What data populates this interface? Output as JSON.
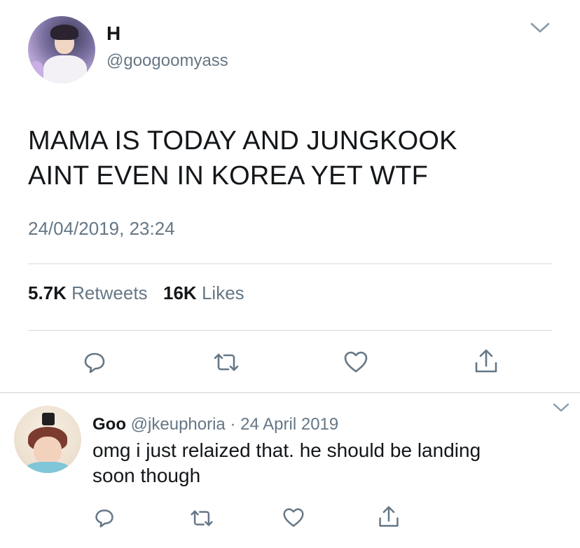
{
  "tweet": {
    "display_name": "H",
    "handle": "@googoomyass",
    "text_line1": "MAMA IS TODAY AND JUNGKOOK",
    "text_line2": "AINT EVEN IN KOREA YET WTF",
    "timestamp": "24/04/2019, 23:24",
    "retweets_count": "5.7K",
    "retweets_label": "Retweets",
    "likes_count": "16K",
    "likes_label": "Likes"
  },
  "reply": {
    "display_name": "Goo",
    "handle": "@jkeuphoria",
    "separator": "·",
    "date": "24 April 2019",
    "text_line1": "omg i just relaized that. he should be landing",
    "text_line2": "soon though"
  },
  "icons": {
    "more": "chevron-down-icon",
    "reply": "reply-bubble-icon",
    "retweet": "retweet-icon",
    "like": "heart-icon",
    "share": "share-icon"
  },
  "colors": {
    "text": "#14171a",
    "secondary": "#657786",
    "divider": "#d6dbdf"
  }
}
